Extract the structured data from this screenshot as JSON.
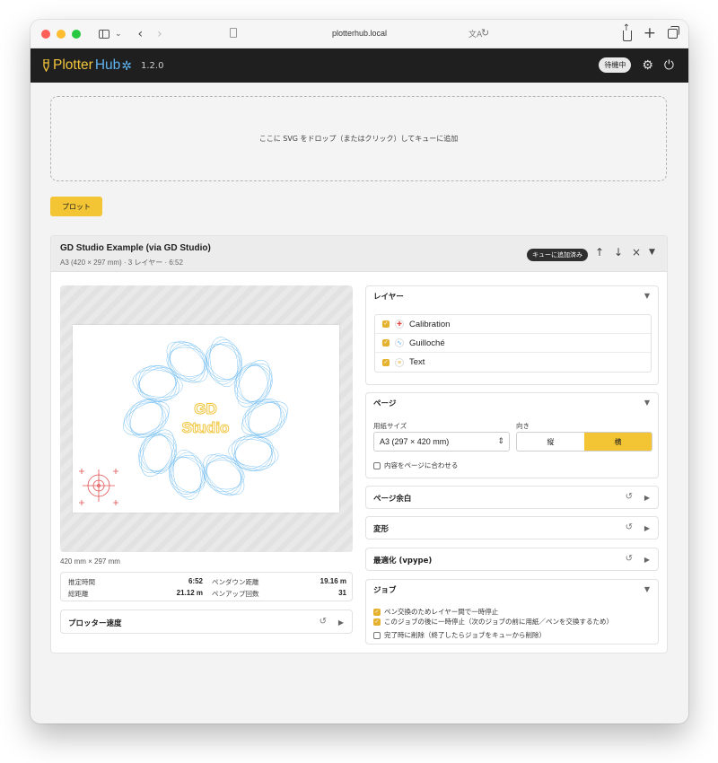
{
  "browser": {
    "url": "plotterhub.local"
  },
  "app": {
    "name_part1": "Plotter",
    "name_part2": "Hub",
    "version": "1.2.0",
    "status": "待機中"
  },
  "dropzone": {
    "text": "ここに SVG をドロップ（またはクリック）してキューに追加"
  },
  "plot_button": "プロット",
  "job": {
    "title": "GD Studio Example (via GD Studio)",
    "subtitle": "A3 (420 × 297 mm) · 3 レイヤー · 6:52",
    "badge": "キューに追加済み",
    "preview_text": [
      "GD",
      "Studio"
    ],
    "dimensions": "420 mm × 297 mm",
    "stats": {
      "est_time_label": "推定時間",
      "est_time": "6:52",
      "pen_down_label": "ペンダウン距離",
      "pen_down": "19.16 m",
      "total_dist_label": "総距離",
      "total_dist": "21.12 m",
      "pen_up_label": "ペンアップ回数",
      "pen_up": "31"
    },
    "speed_panel": "プロッター速度"
  },
  "layers": {
    "title": "レイヤー",
    "items": [
      {
        "name": "Calibration",
        "icon": "✚",
        "color": "#e04848"
      },
      {
        "name": "Guilloché",
        "icon": "∿",
        "color": "#5eb4f0"
      },
      {
        "name": "Text",
        "icon": "≡",
        "color": "#f2c53c"
      }
    ]
  },
  "page": {
    "title": "ページ",
    "paper_size_label": "用紙サイズ",
    "paper_size": "A3 (297 × 420 mm)",
    "orientation_label": "向き",
    "portrait": "縦",
    "landscape": "横",
    "fit_label": "内容をページに合わせる"
  },
  "panels": {
    "margin": "ページ余白",
    "transform": "変形",
    "optimize": "最適化 (vpype)"
  },
  "job_panel": {
    "title": "ジョブ",
    "opt1": "ペン交換のためレイヤー間で一時停止",
    "opt2": "このジョブの後に一時停止（次のジョブの前に用紙／ペンを交換するため）",
    "opt3": "完了時に削除（終了したらジョブをキューから削除）"
  },
  "colors": {
    "accent": "#f3c433",
    "header_bg": "#1f1f1f",
    "guilloche": "#5eb4f0",
    "calibration": "#e04848"
  }
}
